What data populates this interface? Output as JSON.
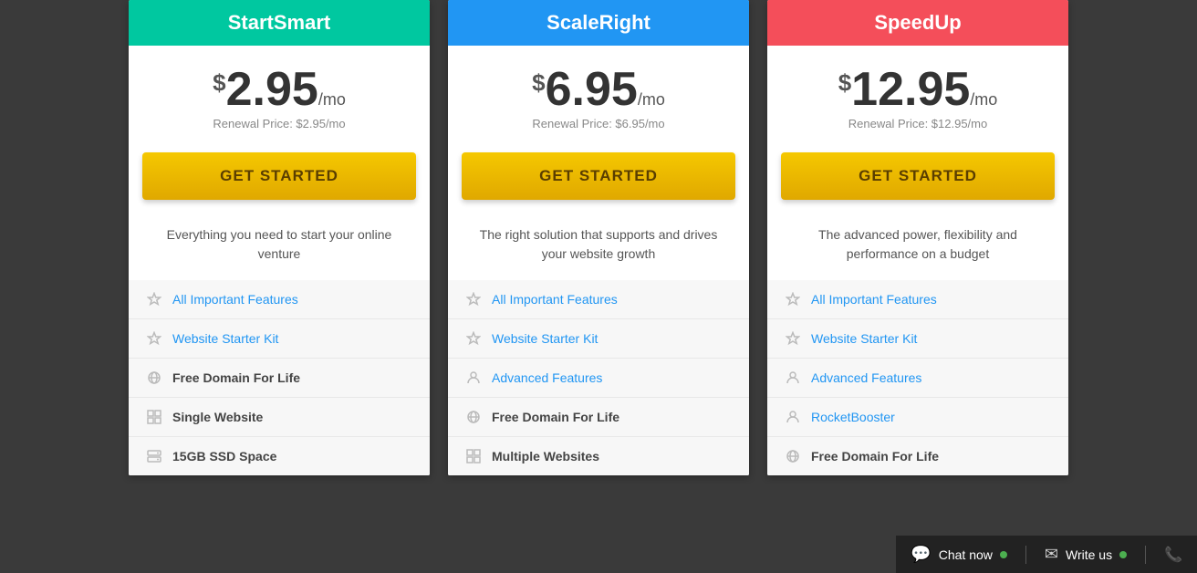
{
  "plans": [
    {
      "id": "startsmart",
      "name": "StartSmart",
      "headerClass": "teal",
      "currency": "$",
      "price": "2.95",
      "perMo": "/mo",
      "renewal": "Renewal Price: $2.95/mo",
      "cta": "GET STARTED",
      "description": "Everything you need to start your online venture",
      "features": [
        {
          "icon": "star",
          "label": "All Important Features",
          "link": true
        },
        {
          "icon": "star",
          "label": "Website Starter Kit",
          "link": true
        },
        {
          "icon": "globe",
          "label": "Free Domain For Life",
          "link": false
        },
        {
          "icon": "grid",
          "label": "Single Website",
          "link": false
        },
        {
          "icon": "server",
          "label": "15GB SSD Space",
          "link": false
        }
      ]
    },
    {
      "id": "scaleright",
      "name": "ScaleRight",
      "headerClass": "blue",
      "currency": "$",
      "price": "6.95",
      "perMo": "/mo",
      "renewal": "Renewal Price: $6.95/mo",
      "cta": "GET STARTED",
      "description": "The right solution that supports and drives your website growth",
      "features": [
        {
          "icon": "star",
          "label": "All Important Features",
          "link": true
        },
        {
          "icon": "star",
          "label": "Website Starter Kit",
          "link": true
        },
        {
          "icon": "person",
          "label": "Advanced Features",
          "link": true
        },
        {
          "icon": "globe",
          "label": "Free Domain For Life",
          "link": false
        },
        {
          "icon": "grid",
          "label": "Multiple Websites",
          "link": false
        }
      ]
    },
    {
      "id": "speedup",
      "name": "SpeedUp",
      "headerClass": "red",
      "currency": "$",
      "price": "12.95",
      "perMo": "/mo",
      "renewal": "Renewal Price: $12.95/mo",
      "cta": "GET STARTED",
      "description": "The advanced power, flexibility and performance on a budget",
      "features": [
        {
          "icon": "star",
          "label": "All Important Features",
          "link": true
        },
        {
          "icon": "star",
          "label": "Website Starter Kit",
          "link": true
        },
        {
          "icon": "person",
          "label": "Advanced Features",
          "link": true
        },
        {
          "icon": "person",
          "label": "RocketBooster",
          "link": true
        },
        {
          "icon": "globe",
          "label": "Free Domain For Life",
          "link": false
        }
      ]
    }
  ],
  "chat": {
    "chat_label": "Chat now",
    "write_label": "Write us",
    "chat_icon": "💬",
    "write_icon": "✉",
    "phone_icon": "📞"
  }
}
